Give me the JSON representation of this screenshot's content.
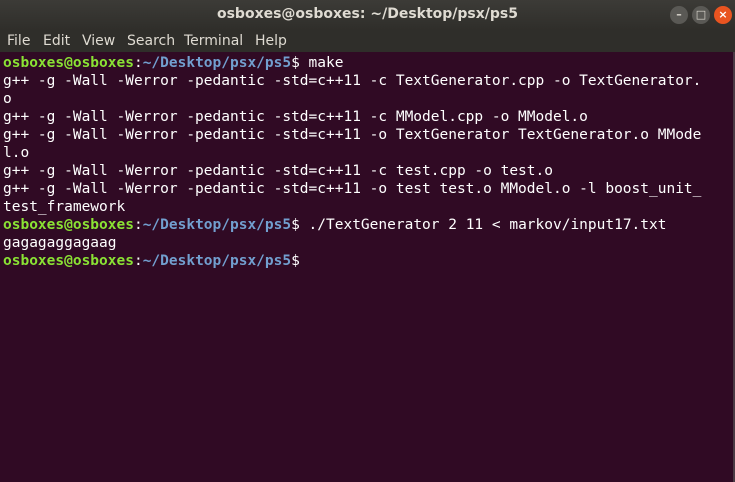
{
  "window": {
    "title": "osboxes@osboxes: ~/Desktop/psx/ps5",
    "buttons": {
      "minimize": "–",
      "maximize": "□",
      "close": "×"
    }
  },
  "menu": [
    "File",
    "Edit",
    "View",
    "Search",
    "Terminal",
    "Help"
  ],
  "prompt": {
    "user": "osboxes@osboxes",
    "sep": ":",
    "path": "~/Desktop/psx/ps5",
    "sym": "$"
  },
  "terminal": {
    "cmd1": " make",
    "out1": "g++ -g -Wall -Werror -pedantic -std=c++11 -c TextGenerator.cpp -o TextGenerator.",
    "out2": "o",
    "out3": "g++ -g -Wall -Werror -pedantic -std=c++11 -c MModel.cpp -o MModel.o",
    "out4": "g++ -g -Wall -Werror -pedantic -std=c++11 -o TextGenerator TextGenerator.o MMode",
    "out5": "l.o",
    "out6": "g++ -g -Wall -Werror -pedantic -std=c++11 -c test.cpp -o test.o",
    "out7": "g++ -g -Wall -Werror -pedantic -std=c++11 -o test test.o MModel.o -l boost_unit_",
    "out8": "test_framework",
    "cmd2": " ./TextGenerator 2 11 < markov/input17.txt",
    "out9": "gagagaggagaag"
  }
}
